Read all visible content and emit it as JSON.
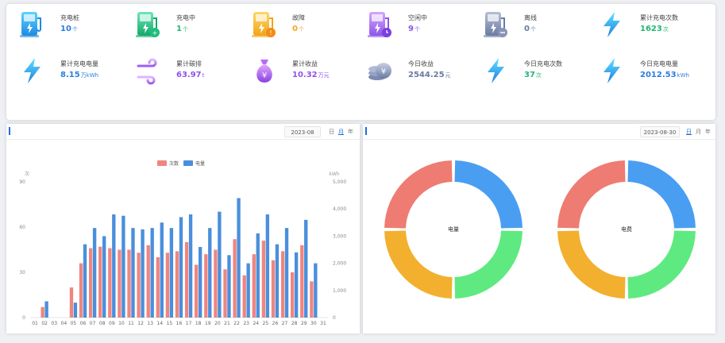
{
  "stats": [
    {
      "label": "充电桩",
      "value": "10",
      "unit": "个",
      "color": "#2b7de1",
      "icon": "charger-icon"
    },
    {
      "label": "充电中",
      "value": "1",
      "unit": "个",
      "color": "#22b573",
      "icon": "charging-icon"
    },
    {
      "label": "故障",
      "value": "0",
      "unit": "个",
      "color": "#f5a623",
      "icon": "fault-icon"
    },
    {
      "label": "空闲中",
      "value": "9",
      "unit": "个",
      "color": "#8e54e9",
      "icon": "idle-icon"
    },
    {
      "label": "离线",
      "value": "0",
      "unit": "个",
      "color": "#6a7ba2",
      "icon": "offline-icon"
    },
    {
      "label": "累计充电次数",
      "value": "1623",
      "unit": "次",
      "color": "#22b573",
      "icon": "lightning-icon"
    },
    {
      "label": "累计充电电量",
      "value": "8.15",
      "unit": "万kWh",
      "color": "#2b7de1",
      "icon": "lightning-icon"
    },
    {
      "label": "累计碳排",
      "value": "63.97",
      "unit": "t",
      "color": "#8e54e9",
      "icon": "wind-icon"
    },
    {
      "label": "累计收益",
      "value": "10.32",
      "unit": "万元",
      "color": "#8e54e9",
      "icon": "money-bag-icon"
    },
    {
      "label": "今日收益",
      "value": "2544.25",
      "unit": "元",
      "color": "#6a7ba2",
      "icon": "coins-icon"
    },
    {
      "label": "今日充电次数",
      "value": "37",
      "unit": "次",
      "color": "#22b573",
      "icon": "lightning-icon"
    },
    {
      "label": "今日充电电量",
      "value": "2012.53",
      "unit": "kWh",
      "color": "#2b7de1",
      "icon": "lightning-icon"
    }
  ],
  "left_panel": {
    "date": "2023-08",
    "periods": [
      "日",
      "月",
      "年"
    ],
    "selected_period": 1
  },
  "right_panel": {
    "date": "2023-08-30",
    "periods": [
      "日",
      "月",
      "年"
    ],
    "selected_period": 0
  },
  "colors": {
    "bar_count": "#ee8680",
    "bar_energy": "#4a8fdc",
    "donut": [
      "#4a9ef2",
      "#5eea80",
      "#f2b02e",
      "#ee7c72"
    ]
  },
  "chart_data": [
    {
      "type": "bar",
      "categories": [
        "01",
        "02",
        "03",
        "04",
        "05",
        "06",
        "07",
        "08",
        "09",
        "10",
        "11",
        "12",
        "13",
        "14",
        "15",
        "16",
        "17",
        "18",
        "19",
        "20",
        "21",
        "22",
        "23",
        "24",
        "25",
        "26",
        "27",
        "28",
        "29",
        "30",
        "31"
      ],
      "series": [
        {
          "name": "次数",
          "axis": "left",
          "values": [
            0,
            7,
            0,
            0,
            20,
            36,
            46,
            47,
            46,
            45,
            45,
            43,
            48,
            40,
            43,
            44,
            50,
            35,
            42,
            45,
            32,
            52,
            28,
            42,
            51,
            38,
            44,
            30,
            48,
            24,
            0
          ]
        },
        {
          "name": "电量",
          "axis": "right",
          "values": [
            0,
            600,
            0,
            0,
            550,
            2700,
            3300,
            3000,
            3800,
            3750,
            3300,
            3250,
            3300,
            3500,
            3300,
            3700,
            3800,
            2600,
            3300,
            3900,
            2300,
            4400,
            2000,
            3100,
            3800,
            2700,
            3300,
            2400,
            3600,
            2000,
            0
          ]
        }
      ],
      "y_left": {
        "min": 0,
        "max": 90,
        "ticks": [
          0,
          30,
          60,
          90
        ],
        "label": "次"
      },
      "y_right": {
        "min": 0,
        "max": 5000,
        "ticks": [
          0,
          1000,
          2000,
          3000,
          4000,
          5000
        ],
        "label": "kWh"
      },
      "legend": [
        "次数",
        "电量"
      ],
      "legend_position": "top-center"
    },
    {
      "type": "pie",
      "title": "电量",
      "values": [
        25,
        25,
        25,
        25
      ]
    },
    {
      "type": "pie",
      "title": "电费",
      "values": [
        25,
        25,
        25,
        25
      ]
    }
  ]
}
